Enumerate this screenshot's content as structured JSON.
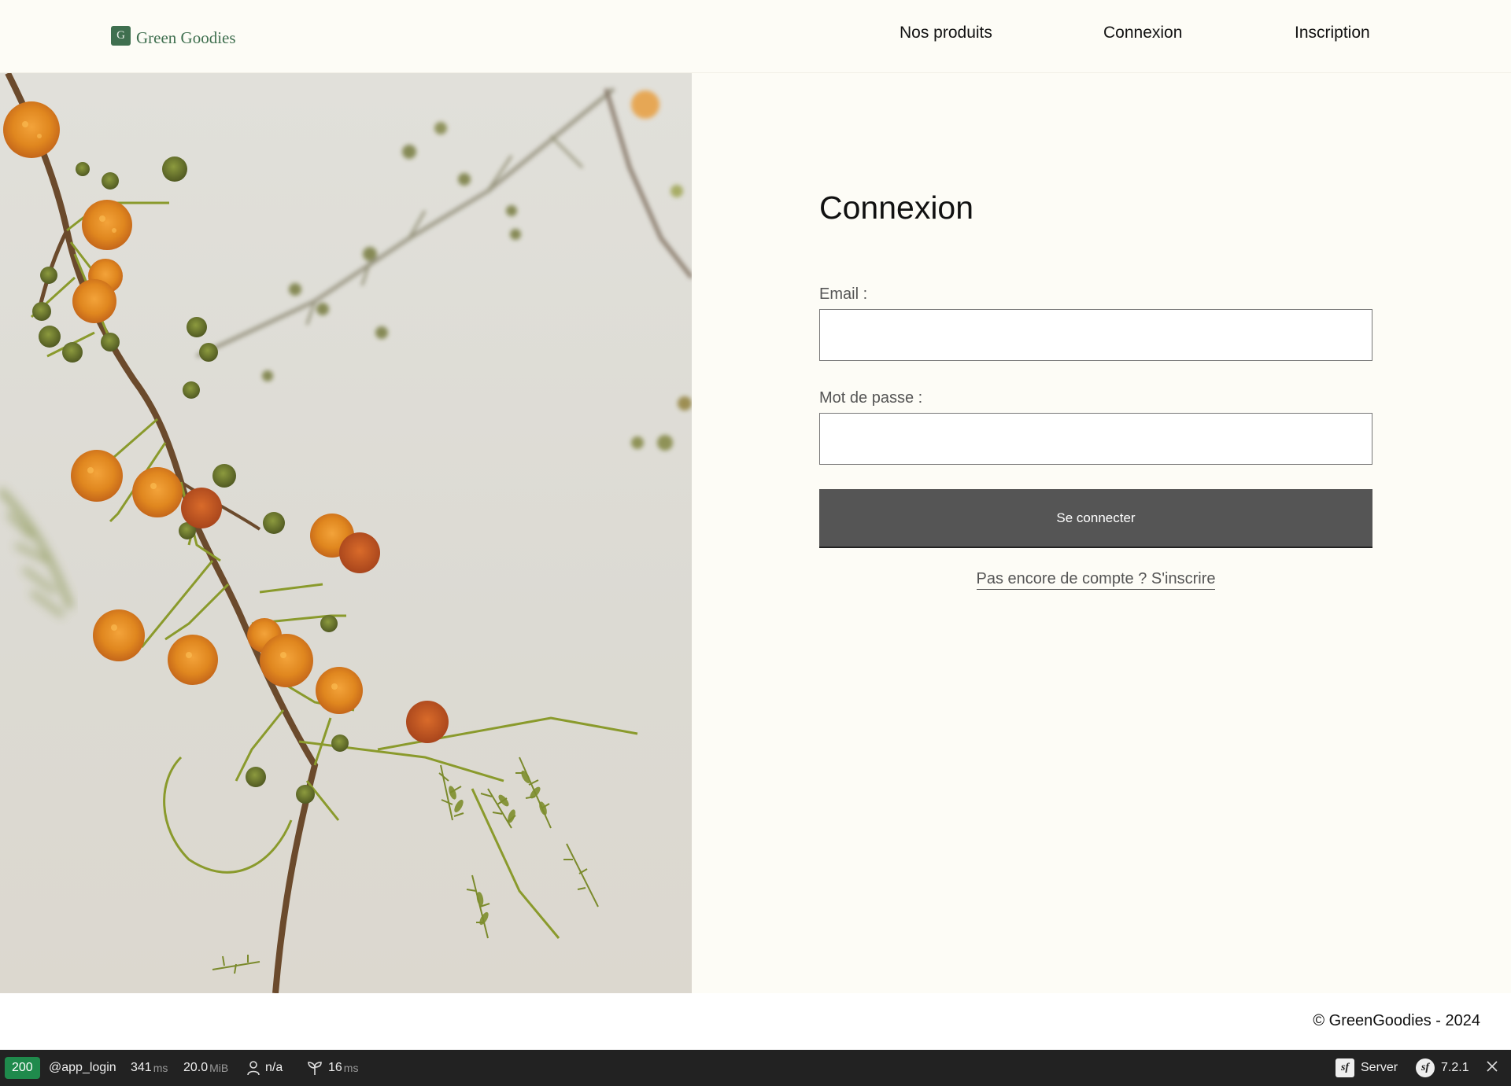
{
  "header": {
    "logo_mark": "G",
    "logo_text": "Green Goodies",
    "nav": {
      "products": "Nos produits",
      "login": "Connexion",
      "register": "Inscription"
    }
  },
  "hero": {
    "image": "acacia-branch-with-orange-blossoms"
  },
  "form": {
    "title": "Connexion",
    "email_label": "Email :",
    "email_value": "",
    "password_label": "Mot de passe :",
    "password_value": "",
    "submit_label": "Se connecter",
    "signup_link": "Pas encore de compte ? S'inscrire"
  },
  "footer": {
    "copyright": "© GreenGoodies - 2024"
  },
  "toolbar": {
    "status": "200",
    "route": "@app_login",
    "time_value": "341",
    "time_unit": "ms",
    "memory_value": "20.0",
    "memory_unit": "MiB",
    "user": "n/a",
    "init_value": "16",
    "init_unit": "ms",
    "server_label": "Server",
    "version": "7.2.1"
  },
  "colors": {
    "brand": "#3f6f4f",
    "button": "#555555",
    "status_ok": "#1f8a4c",
    "toolbar_bg": "#222222",
    "page_bg": "#fdfcf6"
  }
}
